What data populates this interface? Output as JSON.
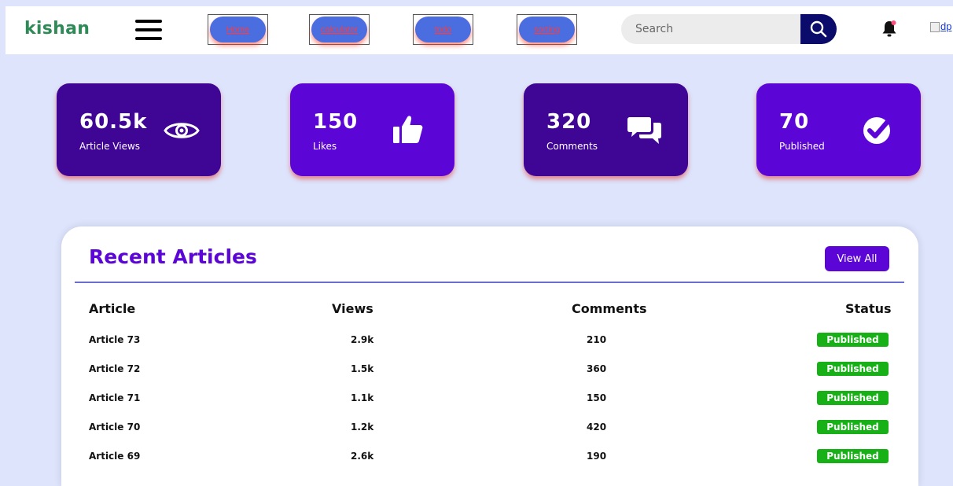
{
  "navbar": {
    "logo": "kishan",
    "links": [
      {
        "label": "Home"
      },
      {
        "label": "calculator"
      },
      {
        "label": "todo"
      },
      {
        "label": "sorting"
      }
    ],
    "search_placeholder": "Search",
    "profile_image_alt": "dp"
  },
  "stats": [
    {
      "value": "60.5k",
      "label": "Article Views",
      "icon": "eye-icon"
    },
    {
      "value": "150",
      "label": "Likes",
      "icon": "thumbs-up-icon"
    },
    {
      "value": "320",
      "label": "Comments",
      "icon": "comments-icon"
    },
    {
      "value": "70",
      "label": "Published",
      "icon": "check-circle-icon"
    }
  ],
  "recent": {
    "title": "Recent Articles",
    "view_all": "View All",
    "columns": [
      "Article",
      "Views",
      "Comments",
      "Status"
    ],
    "rows": [
      {
        "article": "Article 73",
        "views": "2.9k",
        "comments": "210",
        "status": "Published"
      },
      {
        "article": "Article 72",
        "views": "1.5k",
        "comments": "360",
        "status": "Published"
      },
      {
        "article": "Article 71",
        "views": "1.1k",
        "comments": "150",
        "status": "Published"
      },
      {
        "article": "Article 70",
        "views": "1.2k",
        "comments": "420",
        "status": "Published"
      },
      {
        "article": "Article 69",
        "views": "2.6k",
        "comments": "190",
        "status": "Published"
      }
    ]
  },
  "colors": {
    "background": "#dde4fc",
    "card_dark": "#3f0595",
    "card_bright": "#5b06d6",
    "logo": "#2e8b57",
    "status_green": "#17b117"
  }
}
